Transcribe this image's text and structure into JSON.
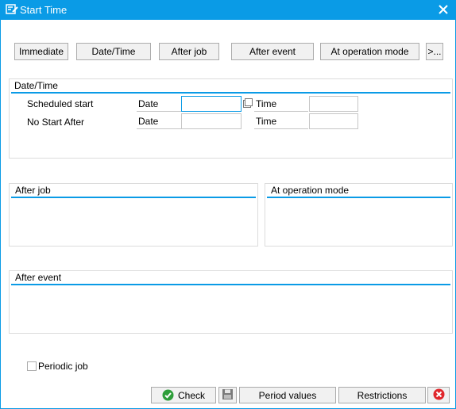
{
  "window": {
    "title": "Start Time",
    "close_icon": "close-icon",
    "title_icon": "edit-window-icon"
  },
  "toolbar": {
    "immediate": "Immediate",
    "date_time": "Date/Time",
    "after_job": "After job",
    "after_event": "After event",
    "at_operation_mode": "At operation mode",
    "more": ">..."
  },
  "date_time_group": {
    "title": "Date/Time",
    "scheduled_start": "Scheduled start",
    "no_start_after": "No Start After",
    "date_label": "Date",
    "time_label": "Time",
    "scheduled_date_value": "",
    "scheduled_time_value": "",
    "no_start_date_value": "",
    "no_start_time_value": ""
  },
  "after_job_group": {
    "title": "After job"
  },
  "at_operation_mode_group": {
    "title": "At operation mode"
  },
  "after_event_group": {
    "title": "After event"
  },
  "periodic_job": {
    "label": "Periodic job",
    "checked": false
  },
  "footer": {
    "check": "Check",
    "period_values": "Period values",
    "restrictions": "Restrictions",
    "save_icon": "save-icon",
    "cancel_icon": "cancel-icon",
    "check_icon": "check-icon"
  },
  "colors": {
    "accent": "#0a9be6",
    "check_green": "#2e9e3a",
    "cancel_red": "#e0262b"
  }
}
